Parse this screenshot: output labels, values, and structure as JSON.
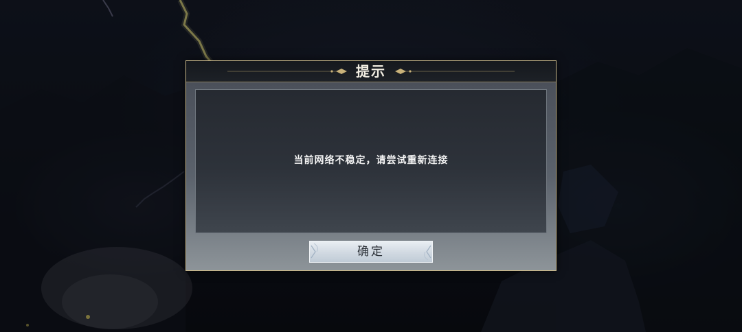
{
  "dialog": {
    "title": "提示",
    "message": "当前网络不稳定，请尝试重新连接",
    "confirm_label": "确定"
  },
  "colors": {
    "frame_gold": "#c9b88a",
    "header_bg": "#15181d",
    "panel_bg": "#262a31",
    "button_bg": "#d3dbe3"
  },
  "icons": {
    "header_left": "ornament-left-icon",
    "header_right": "ornament-right-icon"
  }
}
